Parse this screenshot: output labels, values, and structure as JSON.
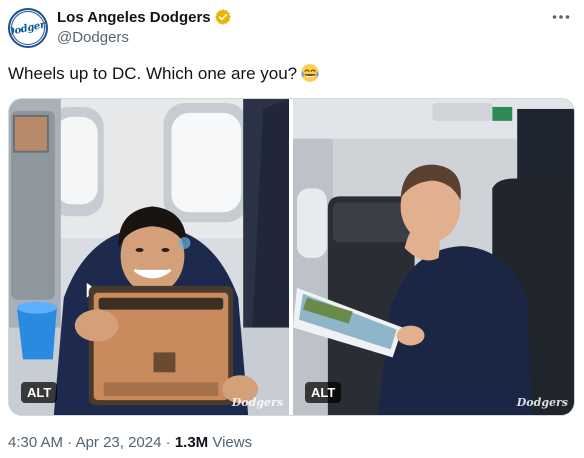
{
  "account": {
    "display_name": "Los Angeles Dodgers",
    "handle": "@Dodgers",
    "avatar_text": "Dodgers",
    "verified_icon": "verified-badge-icon",
    "verified_color": "#e8b400"
  },
  "tweet": {
    "text": "Wheels up to DC. Which one are you?",
    "emoji": "face-with-tears-of-joy"
  },
  "media": [
    {
      "alt_label": "ALT",
      "watermark": "Dodgers"
    },
    {
      "alt_label": "ALT",
      "watermark": "Dodgers"
    }
  ],
  "meta": {
    "time": "4:30 AM",
    "separator": "·",
    "date": "Apr 23, 2024",
    "views_count": "1.3M",
    "views_label": "Views"
  },
  "colors": {
    "brand_blue": "#005a9c",
    "text_primary": "#0f1419",
    "text_secondary": "#536471"
  }
}
